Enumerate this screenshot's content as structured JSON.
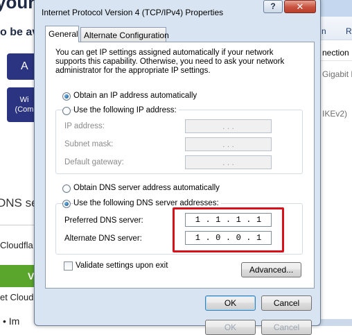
{
  "background_page": {
    "heading_fragment": "your",
    "subheading_fragment": "o be av",
    "apple_button_fragment": "A",
    "windows_button_line1": "Wi",
    "windows_button_line2": "(Com",
    "dns_heading_fragment": "DNS se",
    "cloudflare_fragment": "Cloudfla",
    "green_button_fragment": "V",
    "get_cloudflare_fragment": "et Cloud",
    "bullet_fragment": "• Im"
  },
  "background_window": {
    "toolbar_item_1": "n",
    "toolbar_item_2": "R",
    "column_header": "nection",
    "row_1": "Gigabit N",
    "row_2": "IKEv2)"
  },
  "dialog": {
    "title": "Internet Protocol Version 4 (TCP/IPv4) Properties",
    "help_label": "?",
    "close_label": "✕",
    "tabs": [
      {
        "label": "General",
        "selected": true
      },
      {
        "label": "Alternate Configuration",
        "selected": false
      }
    ],
    "description": "You can get IP settings assigned automatically if your network supports this capability. Otherwise, you need to ask your network administrator for the appropriate IP settings.",
    "ip_section": {
      "auto_option": {
        "label": "Obtain an IP address automatically",
        "selected": true
      },
      "manual_option": {
        "label": "Use the following IP address:",
        "selected": false
      },
      "fields": [
        {
          "label": "IP address:",
          "value": ". . ."
        },
        {
          "label": "Subnet mask:",
          "value": ". . ."
        },
        {
          "label": "Default gateway:",
          "value": ". . ."
        }
      ]
    },
    "dns_section": {
      "auto_option": {
        "label": "Obtain DNS server address automatically",
        "selected": false
      },
      "manual_option": {
        "label": "Use the following DNS server addresses:",
        "selected": true
      },
      "preferred": {
        "label": "Preferred DNS server:",
        "octets": [
          "1",
          "1",
          "1",
          "1"
        ]
      },
      "alternate": {
        "label": "Alternate DNS server:",
        "octets": [
          "1",
          "0",
          "0",
          "1"
        ]
      }
    },
    "validate_checkbox": {
      "label": "Validate settings upon exit",
      "checked": false
    },
    "advanced_button": "Advanced...",
    "ok_button": "OK",
    "cancel_button": "Cancel",
    "hidden_ok_button": "OK",
    "hidden_cancel_button": "Cancel"
  },
  "colors": {
    "dialog_frame": "#d8e4f1",
    "close_button": "#c7523e",
    "highlight_box": "#d8101a",
    "background_button": "#2b3481",
    "background_green": "#5aa52b"
  }
}
